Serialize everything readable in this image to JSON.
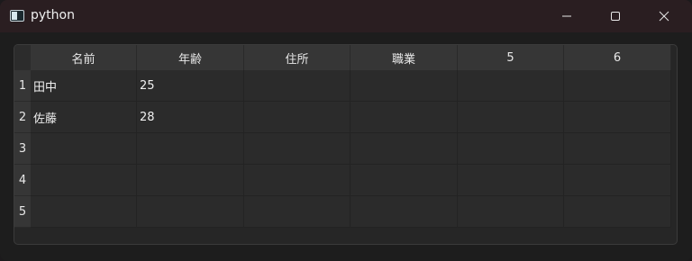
{
  "window": {
    "title": "python"
  },
  "table": {
    "columns": [
      "名前",
      "年齢",
      "住所",
      "職業",
      "5",
      "6"
    ],
    "row_labels": [
      "1",
      "2",
      "3",
      "4",
      "5"
    ],
    "rows": [
      [
        "田中",
        "25",
        "",
        "",
        "",
        ""
      ],
      [
        "佐藤",
        "28",
        "",
        "",
        "",
        ""
      ],
      [
        "",
        "",
        "",
        "",
        "",
        ""
      ],
      [
        "",
        "",
        "",
        "",
        "",
        ""
      ],
      [
        "",
        "",
        "",
        "",
        "",
        ""
      ]
    ]
  }
}
